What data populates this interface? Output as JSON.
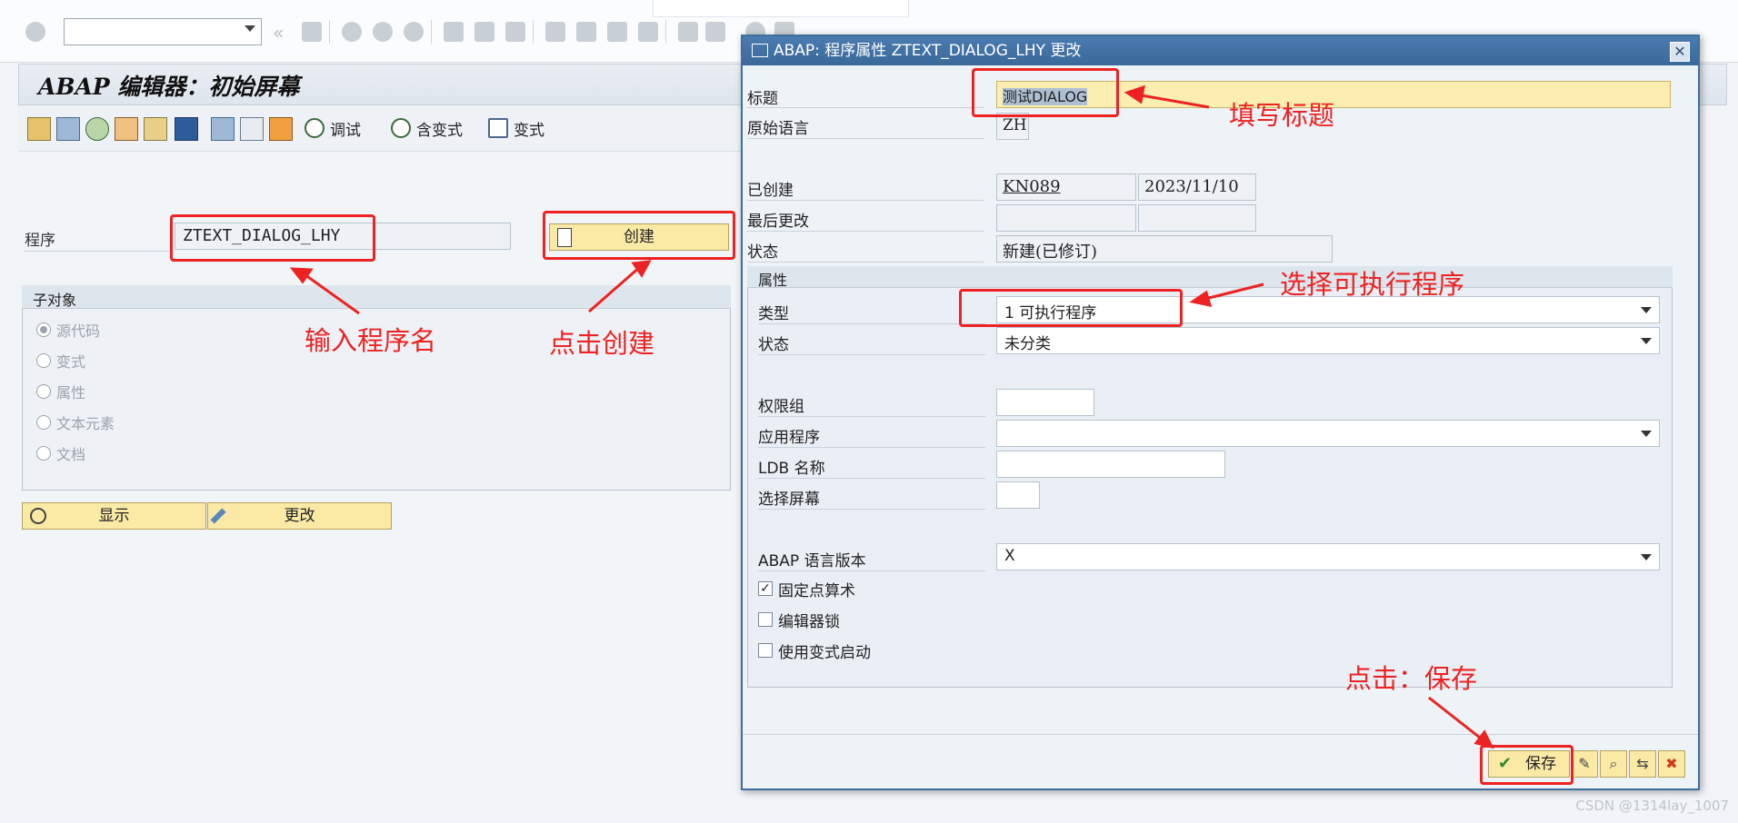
{
  "editor": {
    "title": "ABAP 编辑器：初始屏幕",
    "toolbar_buttons": [
      "调试",
      "含变式",
      "变式"
    ],
    "program_label": "程序",
    "program_value": "ZTEXT_DIALOG_LHY",
    "create_button": "创建",
    "subobjects_title": "子对象",
    "subobjects": [
      {
        "label": "源代码",
        "selected": true
      },
      {
        "label": "变式",
        "selected": false
      },
      {
        "label": "属性",
        "selected": false
      },
      {
        "label": "文本元素",
        "selected": false
      },
      {
        "label": "文档",
        "selected": false
      }
    ],
    "display_button": "显示",
    "change_button": "更改"
  },
  "dialog": {
    "title": "ABAP: 程序属性 ZTEXT_DIALOG_LHY 更改",
    "title_label": "标题",
    "title_value": "测试DIALOG",
    "orig_lang_label": "原始语言",
    "orig_lang_value": "ZH",
    "created_label": "已创建",
    "created_by": "KN089",
    "created_date": "2023/11/10",
    "last_changed_label": "最后更改",
    "status_label": "状态",
    "status_value": "新建(已修订)",
    "attributes_title": "属性",
    "type_label": "类型",
    "type_value": "1 可执行程序",
    "attr_status_label": "状态",
    "attr_status_value": "未分类",
    "auth_group_label": "权限组",
    "application_label": "应用程序",
    "ldb_label": "LDB 名称",
    "select_screen_label": "选择屏幕",
    "abap_version_label": "ABAP 语言版本",
    "abap_version_value": "X",
    "checkboxes": [
      {
        "label": "固定点算术",
        "checked": true
      },
      {
        "label": "编辑器锁",
        "checked": false
      },
      {
        "label": "使用变式启动",
        "checked": false
      }
    ],
    "save_button": "保存"
  },
  "annotations": {
    "enter_program": "输入程序名",
    "click_create": "点击创建",
    "fill_title": "填写标题",
    "select_type": "选择可执行程序",
    "click_save": "点击：保存"
  },
  "watermark": "CSDN @1314lay_1007",
  "colors": {
    "annotation_red": "#ee2222",
    "button_yellow": "#fbe9a6",
    "dialog_blue": "#3f6f9f"
  }
}
